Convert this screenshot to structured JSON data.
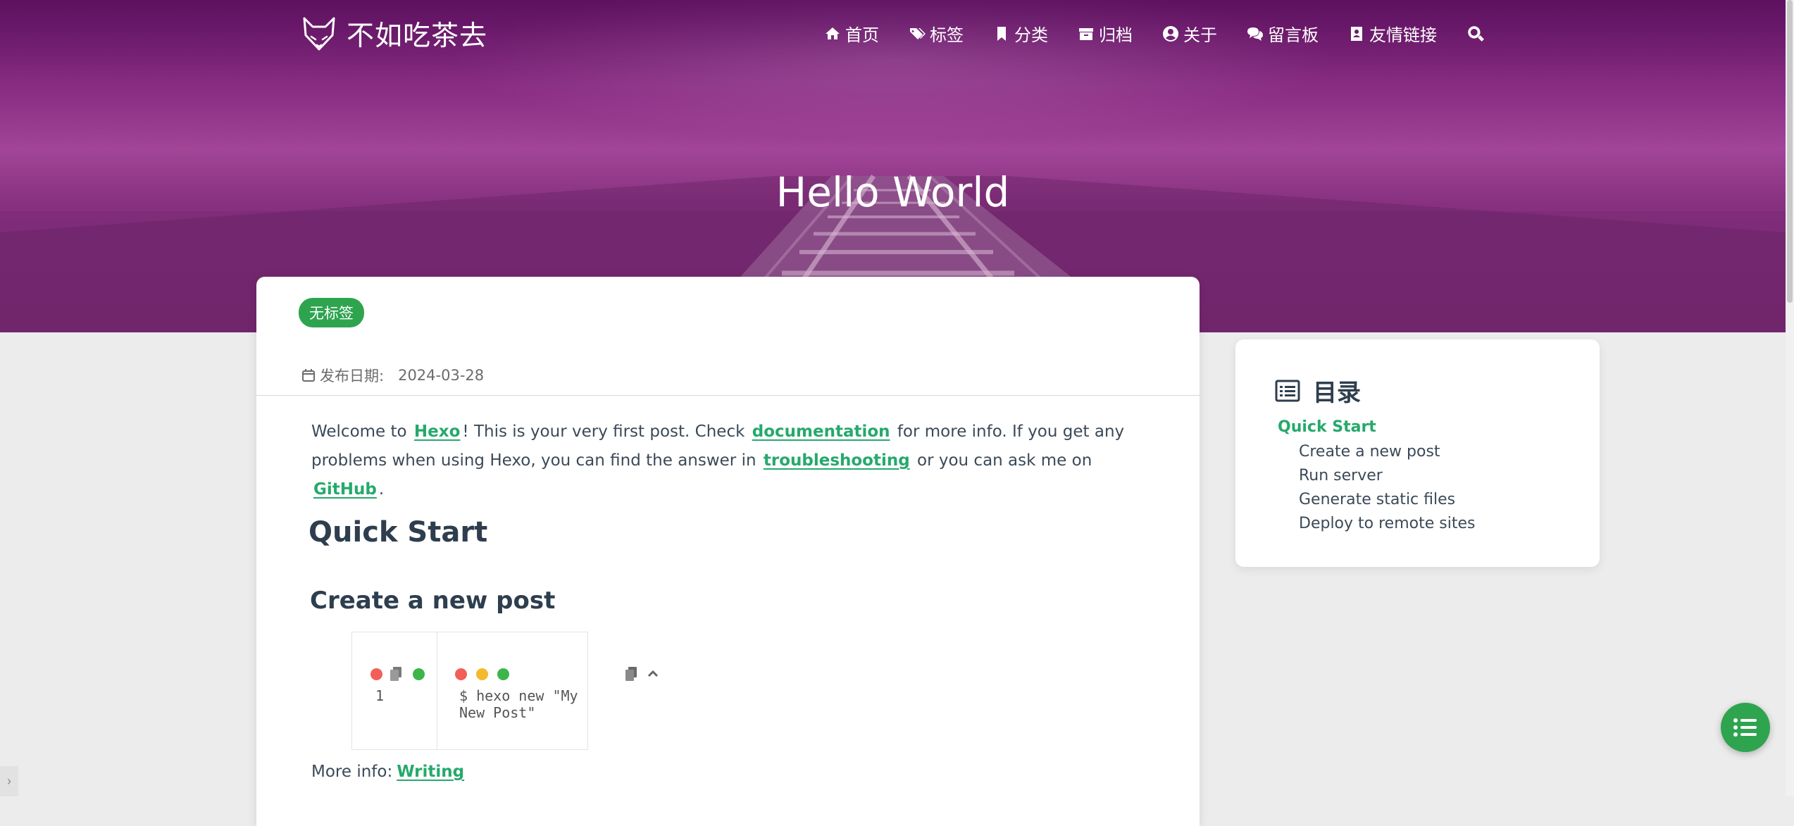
{
  "brand": {
    "name": "不如吃茶去"
  },
  "nav": {
    "items": [
      {
        "label": "首页",
        "icon": "home-icon"
      },
      {
        "label": "标签",
        "icon": "tags-icon"
      },
      {
        "label": "分类",
        "icon": "bookmark-icon"
      },
      {
        "label": "归档",
        "icon": "archive-icon"
      },
      {
        "label": "关于",
        "icon": "user-circle-icon"
      },
      {
        "label": "留言板",
        "icon": "comments-icon"
      },
      {
        "label": "友情链接",
        "icon": "address-book-icon"
      }
    ],
    "search_icon": "search-icon"
  },
  "hero": {
    "title": "Hello World"
  },
  "post": {
    "tag": "无标签",
    "date_label": "发布日期:",
    "date": "2024-03-28",
    "intro": {
      "t1": "Welcome to",
      "link_hexo": "Hexo",
      "t2": "! This is your very first post. Check",
      "link_docs": "documentation",
      "t3": "for more info. If you get any problems when using Hexo, you can find the answer in",
      "link_trouble": "troubleshooting",
      "t4": "or you can ask me on",
      "link_github": "GitHub",
      "t5": "."
    },
    "h1": "Quick Start",
    "h2": "Create a new post",
    "code": {
      "line_number": "1",
      "line": "$ hexo new \"My New Post\""
    },
    "more_label": "More info:",
    "more_link": "Writing"
  },
  "toc": {
    "title": "目录",
    "level1": "Quick Start",
    "level2": [
      "Create a new post",
      "Run server",
      "Generate static files",
      "Deploy to remote sites"
    ]
  },
  "colors": {
    "accent": "#26a96c",
    "tag_bg": "#2ea44f",
    "hero": "#8a2e84"
  }
}
